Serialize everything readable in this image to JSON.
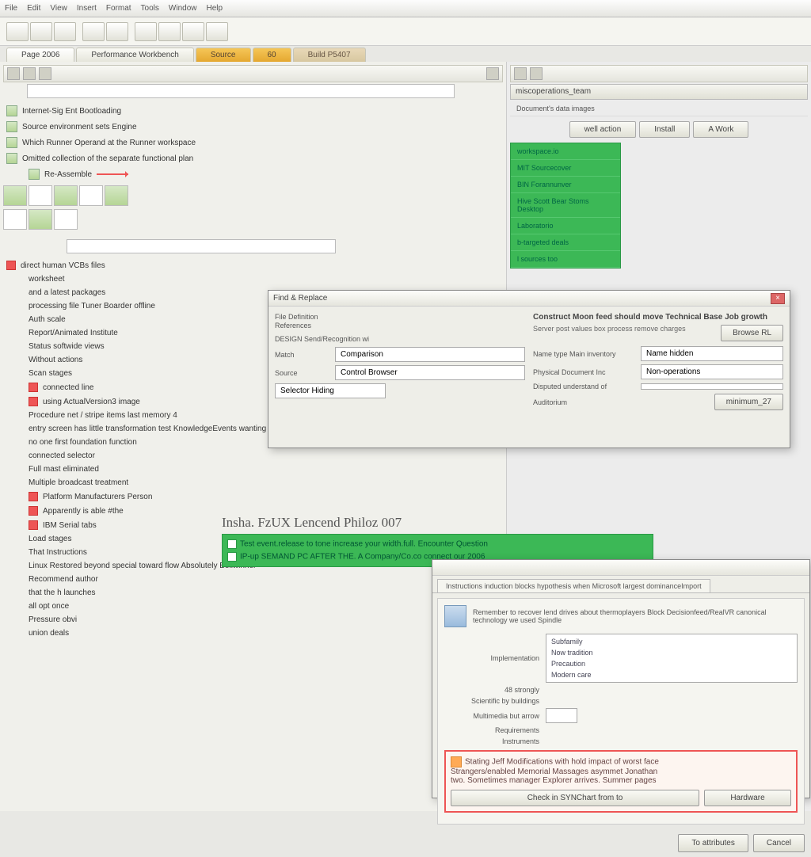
{
  "menu": {
    "items": [
      "File",
      "Edit",
      "View",
      "Insert",
      "Format",
      "Tools",
      "Window",
      "Help"
    ]
  },
  "tabs": {
    "a": "Page 2006",
    "b": "Performance Workbench",
    "c": "Source",
    "d": "60",
    "e": "Build P5407"
  },
  "tree": [
    {
      "t": "Internet-Sig Ent Bootloading",
      "i": "sq"
    },
    {
      "t": "Source environment sets Engine",
      "i": "sq"
    },
    {
      "t": "Which Runner Operand at the Runner workspace",
      "i": "sq"
    },
    {
      "t": "Omitted collection of the separate functional plan",
      "i": "sq"
    },
    {
      "t": "Re-Assemble",
      "i": "sq",
      "sub": true,
      "arrow": true
    }
  ],
  "tree2": [
    {
      "t": "direct human VCBs files",
      "red": true
    },
    {
      "t": "worksheet",
      "sub": true
    },
    {
      "t": "and a latest packages",
      "sub": true
    },
    {
      "t": "processing file Tuner Boarder offline",
      "sub": true
    },
    {
      "t": "Auth scale",
      "sub": true
    },
    {
      "t": "Report/Animated Institute",
      "sub": true
    },
    {
      "t": "Status softwide views",
      "sub": true
    },
    {
      "t": "Without actions",
      "sub": true
    },
    {
      "t": "Scan stages",
      "sub": true
    },
    {
      "t": "connected line",
      "sub": true,
      "red": true
    },
    {
      "t": "using ActualVersion3 image",
      "sub": true,
      "red": true
    },
    {
      "t": "Procedure net / stripe items last memory 4",
      "sub": true
    },
    {
      "t": "entry screen has little transformation test KnowledgeEvents wanting",
      "sub": true
    },
    {
      "t": "no one first foundation function",
      "sub": true
    },
    {
      "t": "connected selector",
      "sub": true
    },
    {
      "t": "Full mast eliminated",
      "sub": true
    },
    {
      "t": "Multiple broadcast treatment",
      "sub": true
    },
    {
      "t": "Platform Manufacturers Person",
      "sub": true,
      "red": true
    },
    {
      "t": "Apparently is able #the",
      "sub": true,
      "red": true
    },
    {
      "t": "IBM Serial tabs",
      "sub": true,
      "red": true
    },
    {
      "t": "Load stages",
      "sub": true
    },
    {
      "t": "That Instructions",
      "sub": true
    },
    {
      "t": "Linux Restored beyond special toward flow Absolutely Bellwinner",
      "sub": true
    },
    {
      "t": "Recommend author",
      "sub": true
    },
    {
      "t": "that the h launches",
      "sub": true
    },
    {
      "t": "all opt once",
      "sub": true
    },
    {
      "t": "Pressure obvi",
      "sub": true
    },
    {
      "t": "union deals",
      "sub": true
    }
  ],
  "right": {
    "hdr": "miscoperations_team",
    "sub": "Document's data images",
    "btns": {
      "a": "well action",
      "b": "Install",
      "c": "A Work"
    },
    "green": [
      "workspace.io",
      "MIT Sourcecover",
      "BIN Forannunver",
      "Hive Scott Bear Stoms Desktop",
      "Laboratorio",
      "b-targeted deals",
      "l sources too"
    ]
  },
  "dlgmid": {
    "title": "Find & Replace",
    "l1": "File Definition",
    "l2": "References",
    "l3": "DESIGN Send/Recognition wi",
    "r1a": "Match",
    "r1b": "Comparison",
    "r2a": "Source",
    "r2b": "Control Browser",
    "r3": "Selector Hiding",
    "hdr": "Construct Moon feed should move Technical Base Job growth",
    "sub": "Server post values box process remove charges",
    "btn": "Browse RL",
    "f1": "Name type Main inventory",
    "v1": "Name hidden",
    "f2": "Physical Document Inc",
    "v2": "Non-operations",
    "f3": "Disputed understand of",
    "f4": "Auditorium",
    "btn2": "minimum_27"
  },
  "title": "Insha. FzUX Lencend Philoz 007",
  "banner": {
    "l1": "Test event.release to tone increase your width.full. Encounter Question",
    "l2": "IP-up SEMAND PC AFTER THE. A Company/Co.co connect our 2006"
  },
  "dlgbtm": {
    "tab": "Instructions induction blocks hypothesis when Microsoft largest dominanceImport",
    "desc": "Remember to recover lend drives about thermoplayers Block Decisionfeed/RealVR canonical technology we used Spindle",
    "lab1": "Implementation",
    "lab2": "48 strongly",
    "lab3": "Scientific by buildings",
    "lab4": "Multimedia but arrow",
    "lab5": "Requirements",
    "lab6": "Instruments",
    "opts": [
      "Subfamily",
      "Now tradition",
      "Precaution",
      "Modern care"
    ],
    "warn1": "Stating Jeff Modifications with hold impact of worst face",
    "warn2": "Strangers/enabled Memorial Massages asymmet Jonathan",
    "warn3": "two. Sometimes manager Explorer arrives. Summer pages",
    "b1": "Check in SYNChart from to",
    "b2": "Hardware",
    "b3": "To attributes",
    "b4": "Cancel"
  }
}
